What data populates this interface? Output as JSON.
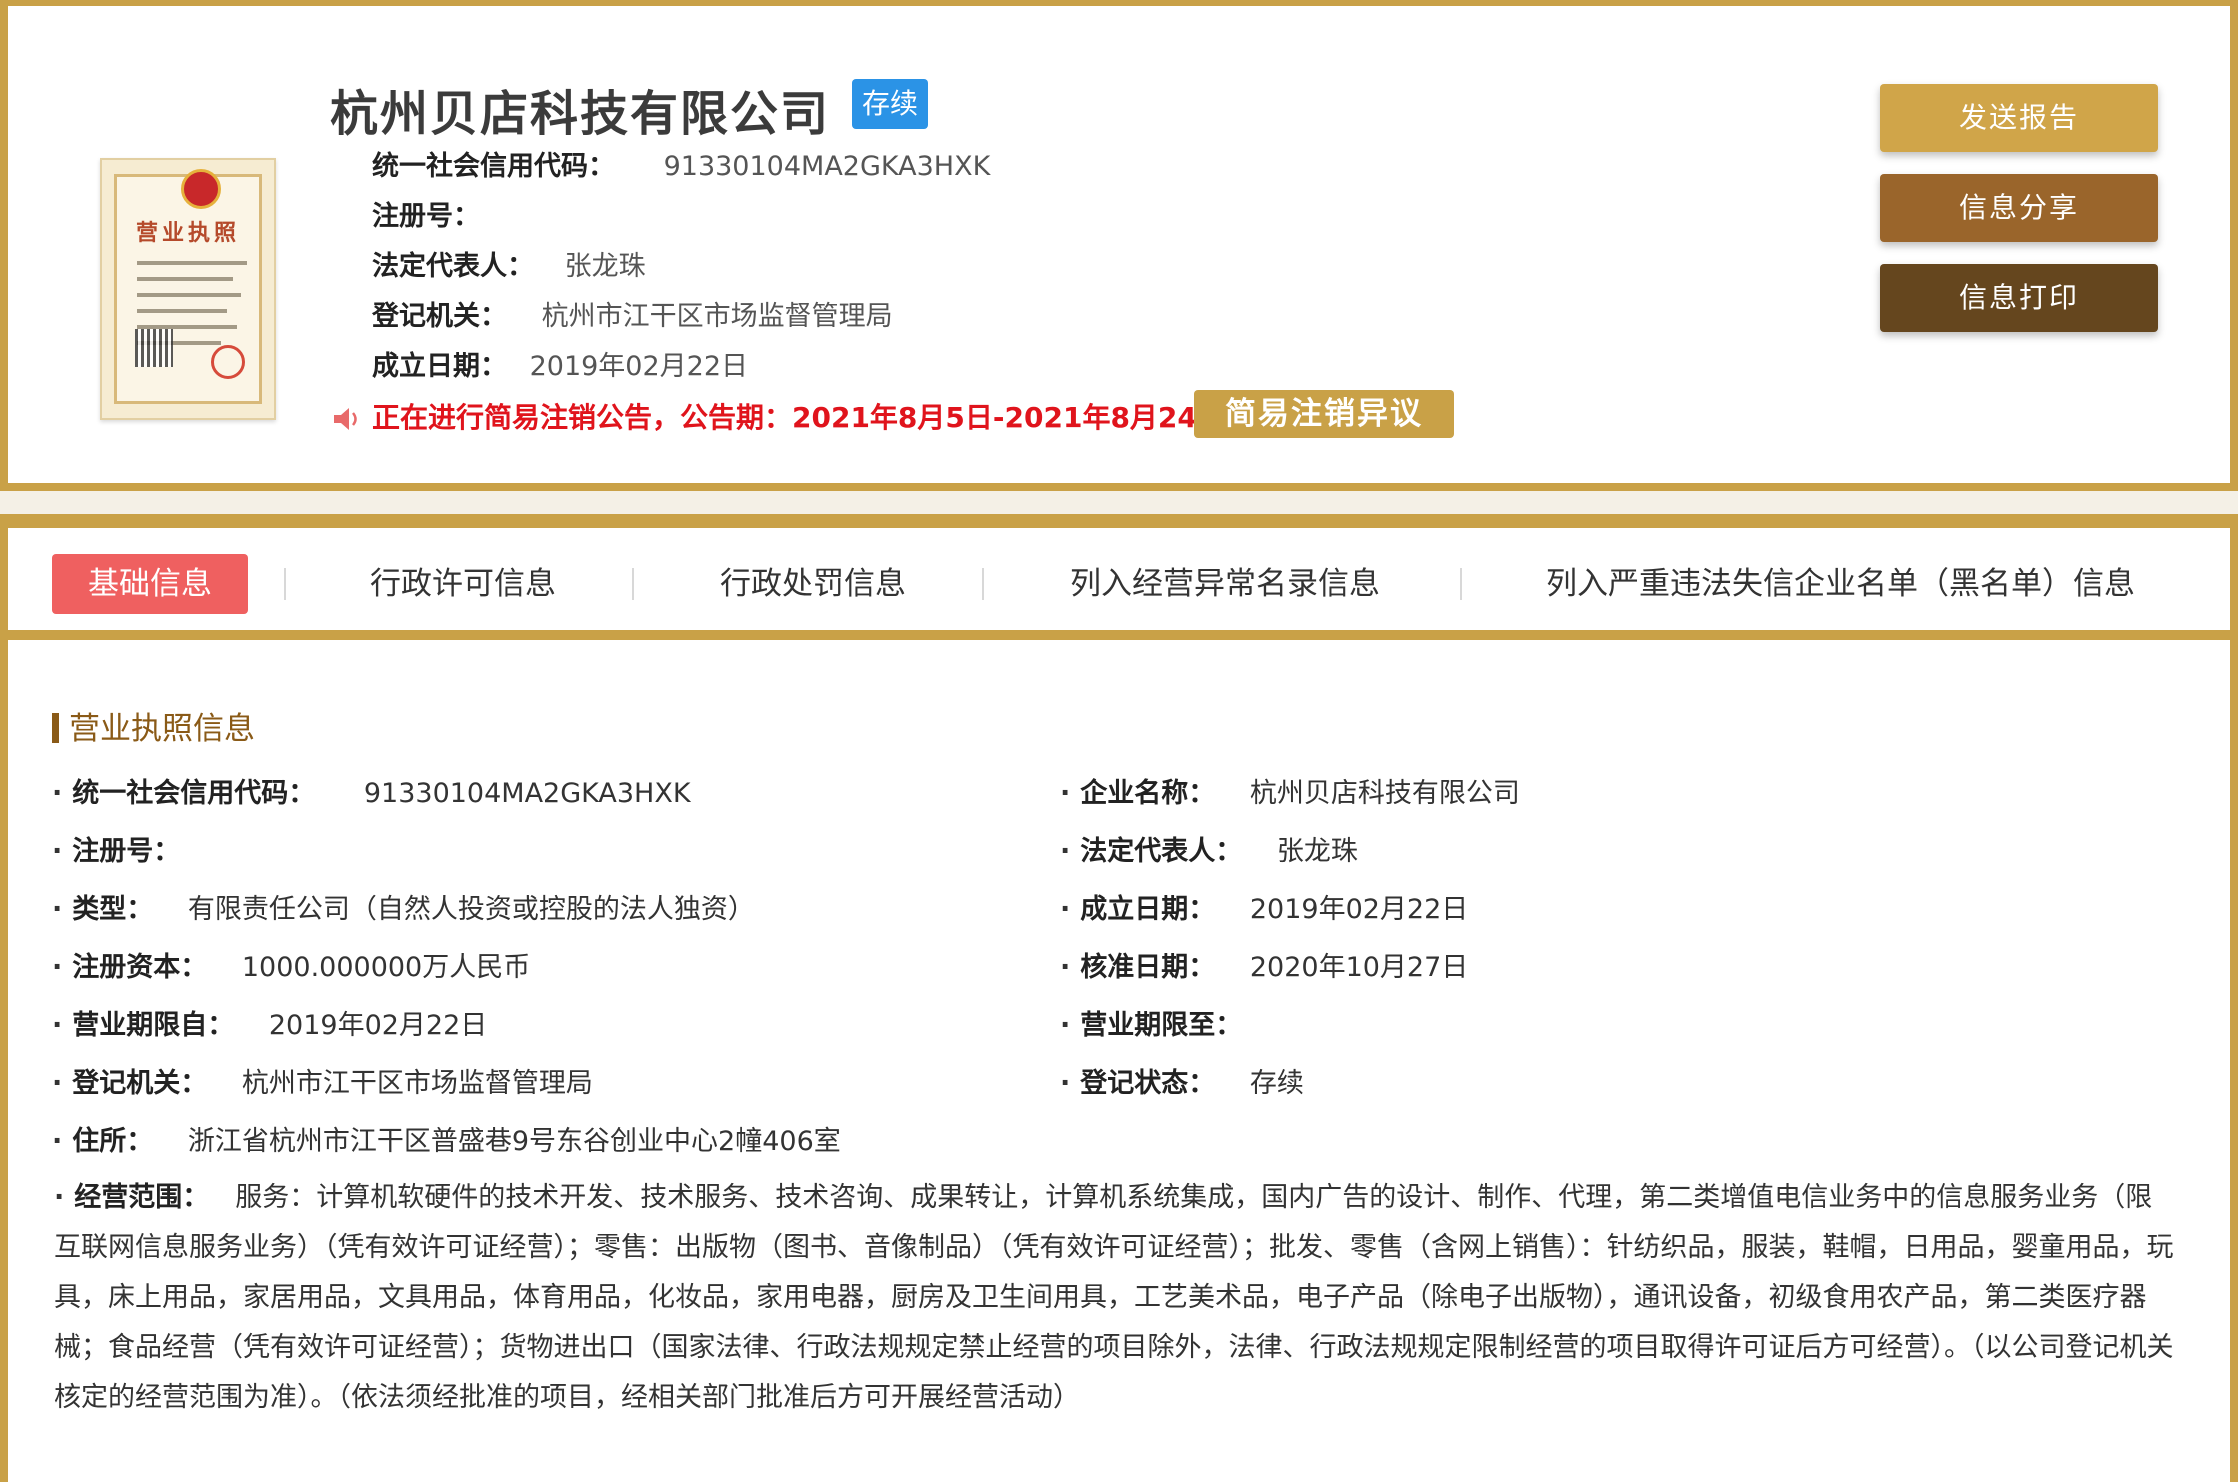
{
  "company": {
    "name": "杭州贝店科技有限公司",
    "status": "存续"
  },
  "basic": {
    "credit_code_label": "统一社会信用代码：",
    "credit_code": "91330104MA2GKA3HXK",
    "reg_no_label": "注册号：",
    "reg_no": "",
    "legal_rep_label": "法定代表人：",
    "legal_rep": "张龙珠",
    "authority_label": "登记机关：",
    "authority": "杭州市江干区市场监督管理局",
    "founded_label": "成立日期：",
    "founded": "2019年02月22日"
  },
  "license_image": {
    "title": "营业执照"
  },
  "notice": {
    "text": "正在进行简易注销公告，公告期：2021年8月5日-2021年8月24日",
    "button": "简易注销异议",
    "icon": "speaker-icon"
  },
  "actions": {
    "send": "发送报告",
    "share": "信息分享",
    "print": "信息打印"
  },
  "tabs": [
    {
      "label": "基础信息",
      "active": true
    },
    {
      "label": "行政许可信息",
      "active": false
    },
    {
      "label": "行政处罚信息",
      "active": false
    },
    {
      "label": "列入经营异常名录信息",
      "active": false
    },
    {
      "label": "列入严重违法失信企业名单（黑名单）信息",
      "active": false
    }
  ],
  "section": {
    "title": "营业执照信息"
  },
  "fields_left": [
    {
      "label": "统一社会信用代码：",
      "value": "91330104MA2GKA3HXK"
    },
    {
      "label": "注册号：",
      "value": ""
    },
    {
      "label": "类型：",
      "value": "有限责任公司（自然人投资或控股的法人独资）"
    },
    {
      "label": "注册资本：",
      "value": "1000.000000万人民币"
    },
    {
      "label": "营业期限自：",
      "value": "2019年02月22日"
    },
    {
      "label": "登记机关：",
      "value": "杭州市江干区市场监督管理局"
    },
    {
      "label": "住所：",
      "value": "浙江省杭州市江干区普盛巷9号东谷创业中心2幢406室"
    }
  ],
  "fields_right": [
    {
      "label": "企业名称：",
      "value": "杭州贝店科技有限公司"
    },
    {
      "label": "法定代表人：",
      "value": "张龙珠"
    },
    {
      "label": "成立日期：",
      "value": "2019年02月22日"
    },
    {
      "label": "核准日期：",
      "value": "2020年10月27日"
    },
    {
      "label": "营业期限至：",
      "value": ""
    },
    {
      "label": "登记状态：",
      "value": "存续"
    }
  ],
  "scope": {
    "label": "经营范围：",
    "value": "服务：计算机软硬件的技术开发、技术服务、技术咨询、成果转让，计算机系统集成，国内广告的设计、制作、代理，第二类增值电信业务中的信息服务业务（限互联网信息服务业务）（凭有效许可证经营）；零售：出版物（图书、音像制品）（凭有效许可证经营）；批发、零售（含网上销售）：针纺织品，服装，鞋帽，日用品，婴童用品，玩具，床上用品，家居用品，文具用品，体育用品，化妆品，家用电器，厨房及卫生间用具，工艺美术品，电子产品（除电子出版物），通讯设备，初级食用农产品，第二类医疗器械；食品经营（凭有效许可证经营）；货物进出口（国家法律、行政法规规定禁止经营的项目除外，法律、行政法规规定限制经营的项目取得许可证后方可经营）。（以公司登记机关核定的经营范围为准）。（依法须经批准的项目，经相关部门批准后方可开展经营活动）"
  },
  "colors": {
    "gold": "#c9a147",
    "brown": "#9a652b",
    "dark_brown": "#65461e",
    "active_tab": "#ef6060",
    "badge_blue": "#2b93e6",
    "notice_red": "#e0141c",
    "section_title": "#8a5a17"
  }
}
